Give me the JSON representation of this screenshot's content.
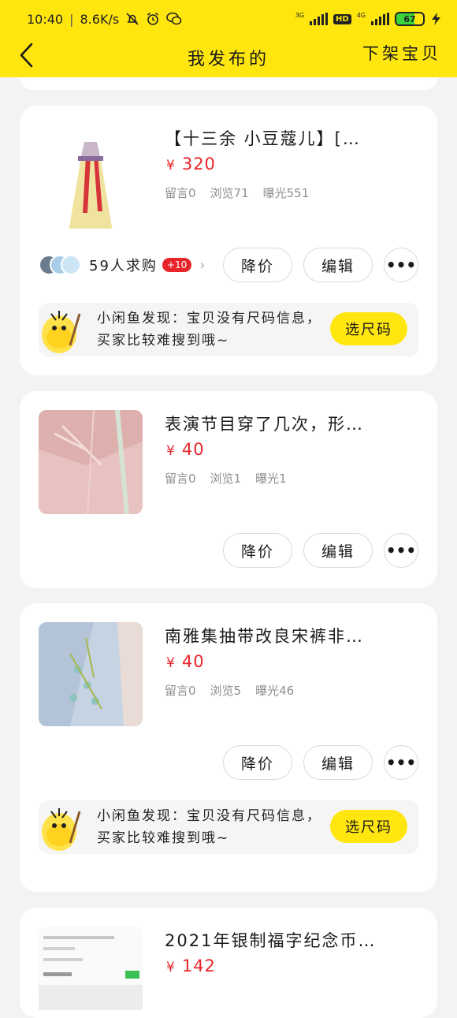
{
  "status": {
    "time": "10:40",
    "speed": "8.6K/s",
    "net1": "3G",
    "hd": "HD",
    "net2": "4G",
    "battery": "67"
  },
  "nav": {
    "title": "我发布的",
    "action": "下架宝贝"
  },
  "actions": {
    "price_cut": "降价",
    "edit": "编辑",
    "more": "•••"
  },
  "tip": {
    "text": "小闲鱼发现：宝贝没有尺码信息，买家比较难搜到哦~",
    "button": "选尺码"
  },
  "items": [
    {
      "title": "【十三余 小豆蔻儿】[…",
      "currency": "¥",
      "price": "320",
      "comments": "留言0",
      "views": "浏览71",
      "exposure": "曝光551",
      "buyers": "59人求购",
      "buyers_badge": "+10"
    },
    {
      "title": "表演节目穿了几次，形…",
      "currency": "¥",
      "price": "40",
      "comments": "留言0",
      "views": "浏览1",
      "exposure": "曝光1"
    },
    {
      "title": "南雅集抽带改良宋裤非…",
      "currency": "¥",
      "price": "40",
      "comments": "留言0",
      "views": "浏览5",
      "exposure": "曝光46"
    },
    {
      "title": "2021年银制福字纪念币…",
      "currency": "¥",
      "price": "142"
    }
  ]
}
